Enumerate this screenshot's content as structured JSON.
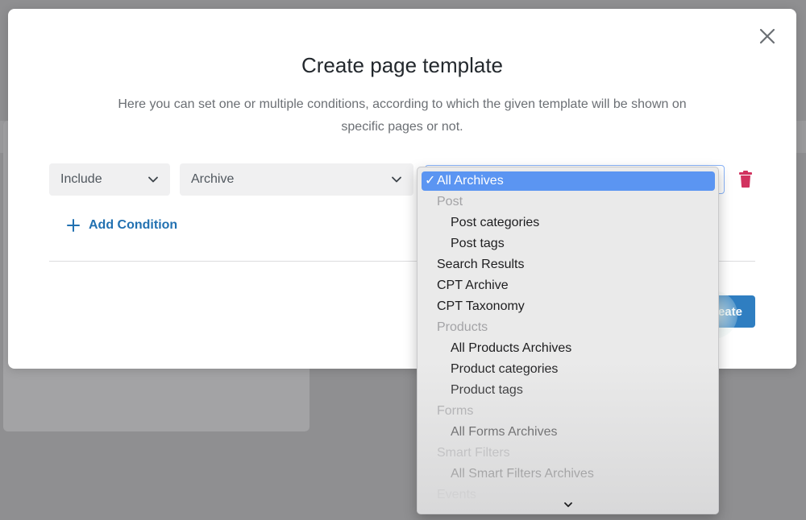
{
  "modal": {
    "title": "Create page template",
    "description": "Here you can set one or multiple conditions, according to which the given template will be shown on specific pages or not.",
    "close_icon": "close-icon"
  },
  "condition": {
    "include_value": "Include",
    "type_value": "Archive",
    "subtype_value": "All Archives"
  },
  "add_condition_label": "Add Condition",
  "create_button_label": "eate",
  "dropdown": {
    "options": [
      {
        "label": "All Archives",
        "kind": "selected"
      },
      {
        "label": "Post",
        "kind": "group"
      },
      {
        "label": "Post categories",
        "kind": "child"
      },
      {
        "label": "Post tags",
        "kind": "child"
      },
      {
        "label": "Search Results",
        "kind": "option"
      },
      {
        "label": "CPT Archive",
        "kind": "option"
      },
      {
        "label": "CPT Taxonomy",
        "kind": "option"
      },
      {
        "label": "Products",
        "kind": "group"
      },
      {
        "label": "All Products Archives",
        "kind": "child"
      },
      {
        "label": "Product categories",
        "kind": "child"
      },
      {
        "label": "Product tags",
        "kind": "child"
      },
      {
        "label": "Forms",
        "kind": "group"
      },
      {
        "label": "All Forms Archives",
        "kind": "child"
      },
      {
        "label": "Smart Filters",
        "kind": "group"
      },
      {
        "label": "All Smart Filters Archives",
        "kind": "child"
      },
      {
        "label": "Events",
        "kind": "group"
      }
    ],
    "check_glyph": "✓"
  },
  "colors": {
    "accent": "#2271b1",
    "trash": "#d1325f",
    "selected": "#5b95f2"
  }
}
